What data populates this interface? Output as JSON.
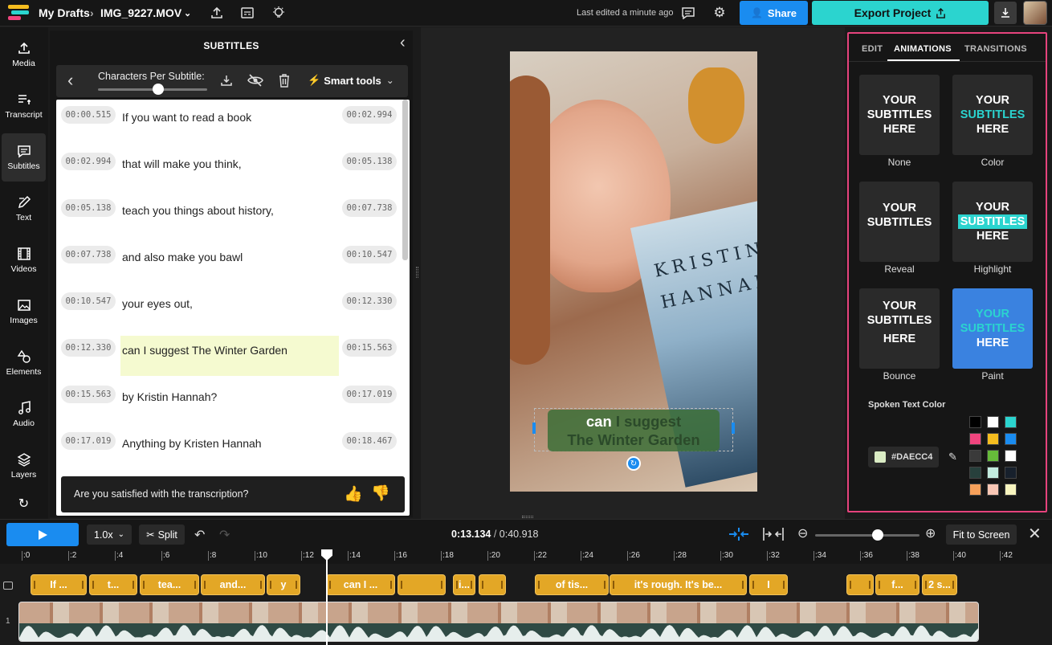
{
  "header": {
    "project": "My Drafts",
    "filename": "IMG_9227.MOV",
    "last_edited": "Last edited a minute ago",
    "share_label": "Share",
    "export_label": "Export Project"
  },
  "rail": [
    {
      "label": "Media",
      "icon": "upload-icon"
    },
    {
      "label": "Transcript",
      "icon": "transcript-icon"
    },
    {
      "label": "Subtitles",
      "icon": "subtitles-icon"
    },
    {
      "label": "Text",
      "icon": "text-icon"
    },
    {
      "label": "Videos",
      "icon": "film-icon"
    },
    {
      "label": "Images",
      "icon": "image-icon"
    },
    {
      "label": "Elements",
      "icon": "shapes-icon"
    },
    {
      "label": "Audio",
      "icon": "music-icon"
    },
    {
      "label": "Layers",
      "icon": "layers-icon"
    }
  ],
  "subtitles": {
    "title": "SUBTITLES",
    "chars_label": "Characters Per Subtitle:",
    "chars_value": 0.55,
    "smart_tools": "Smart tools",
    "rows": [
      {
        "start": "00:00.515",
        "text": "If you want to read a book",
        "end": "00:02.994"
      },
      {
        "start": "00:02.994",
        "text": "that will make you think,",
        "end": "00:05.138"
      },
      {
        "start": "00:05.138",
        "text": "teach you things about history,",
        "end": "00:07.738"
      },
      {
        "start": "00:07.738",
        "text": "and also make you bawl",
        "end": "00:10.547"
      },
      {
        "start": "00:10.547",
        "text": "your eyes out,",
        "end": "00:12.330"
      },
      {
        "start": "00:12.330",
        "text": "can I suggest The Winter Garden",
        "end": "00:15.563"
      },
      {
        "start": "00:15.563",
        "text": "by Kristin Hannah?",
        "end": "00:17.019"
      },
      {
        "start": "00:17.019",
        "text": "Anything by Kristen Hannah",
        "end": "00:18.467"
      }
    ],
    "feedback": "Are you satisfied with the transcription?"
  },
  "preview": {
    "caption_line1_a": "can",
    "caption_line1_b": " I suggest",
    "caption_line2": "The Winter Garden",
    "book_text": "KRISTIN HANNAH"
  },
  "right": {
    "tabs": [
      "EDIT",
      "ANIMATIONS",
      "TRANSITIONS"
    ],
    "sample": [
      "YOUR",
      "SUBTITLES",
      "HERE"
    ],
    "styles": [
      "None",
      "Color",
      "Reveal",
      "Highlight",
      "Bounce",
      "Paint"
    ],
    "spoken_color_label": "Spoken Text Color",
    "spoken_color_hex": "#DAECC4",
    "swatches": [
      "#000000",
      "#ffffff",
      "#2bd4cf",
      "#f0457e",
      "#f5bd1f",
      "#1a8cf0",
      "#3a3a3a",
      "#66bb3a",
      "#ffffff",
      "#27403c",
      "#c3ecdf",
      "#17202c",
      "#f6a05a",
      "#f9c7b5",
      "#f8f5bf"
    ]
  },
  "timeline": {
    "speed": "1.0x",
    "split": "Split",
    "current_time": "0:13.134",
    "total_time": "0:40.918",
    "zoom": 0.6,
    "fit_label": "Fit to Screen",
    "ticks": [
      ":0",
      ":2",
      ":4",
      ":6",
      ":8",
      ":10",
      ":12",
      ":14",
      ":16",
      ":18",
      ":20",
      ":22",
      ":24",
      ":26",
      ":28",
      ":30",
      ":32",
      ":34",
      ":36",
      ":38",
      ":40",
      ":42"
    ],
    "clips": [
      "If ...",
      "t...",
      "tea...",
      "and...",
      "y",
      "can I ...",
      "",
      "i...",
      "",
      "of tis...",
      "it's rough. It's be...",
      "I",
      "",
      "f...",
      "2 s..."
    ]
  }
}
